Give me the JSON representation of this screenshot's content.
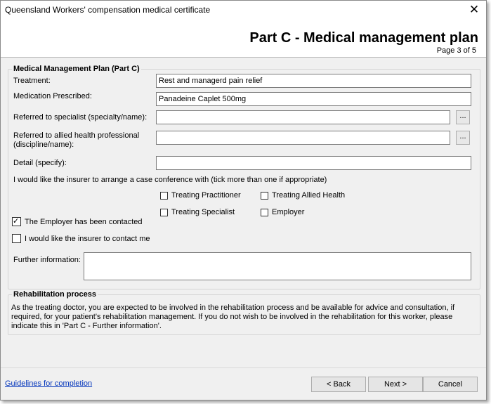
{
  "window": {
    "title": "Queensland Workers' compensation medical certificate",
    "close_glyph": "✕"
  },
  "header": {
    "heading": "Part C - Medical management plan",
    "page": "Page 3 of 5"
  },
  "plan": {
    "group_title": "Medical Management Plan (Part C)",
    "treatment_label": "Treatment:",
    "treatment_value": "Rest and managerd pain relief",
    "medication_label": "Medication Prescribed:",
    "medication_value": "Panadeine Caplet 500mg",
    "specialist_label": "Referred to specialist (specialty/name):",
    "specialist_value": "",
    "allied_label_1": "Referred to allied health professional",
    "allied_label_2": "(discipline/name):",
    "allied_value": "",
    "browse_label": "...",
    "detail_label": "Detail (specify):",
    "detail_value": "",
    "conference_text": "I would like the insurer to arrange a case conference with (tick more than one if appropriate)",
    "conference_options": [
      {
        "label": "Treating Practitioner",
        "checked": false
      },
      {
        "label": "Treating Allied Health",
        "checked": false
      },
      {
        "label": "Treating Specialist",
        "checked": false
      },
      {
        "label": "Employer",
        "checked": false
      }
    ],
    "employer_contacted": {
      "label": "The Employer has been contacted",
      "checked": true
    },
    "insurer_contact": {
      "label": "I would like the insurer to contact me",
      "checked": false
    },
    "further_label": "Further information:",
    "further_value": ""
  },
  "rehab": {
    "group_title": "Rehabilitation process",
    "text": "As the treating doctor, you are expected to be involved in the rehabilitation process and be available for advice and consultation, if required, for your patient's rehabilitation management. If you do not wish to be involved in the rehabilitation for this worker, please indicate this in 'Part C - Further information'."
  },
  "footer": {
    "guidelines": "Guidelines for completion",
    "back": "< Back",
    "next": "Next >",
    "cancel": "Cancel"
  }
}
